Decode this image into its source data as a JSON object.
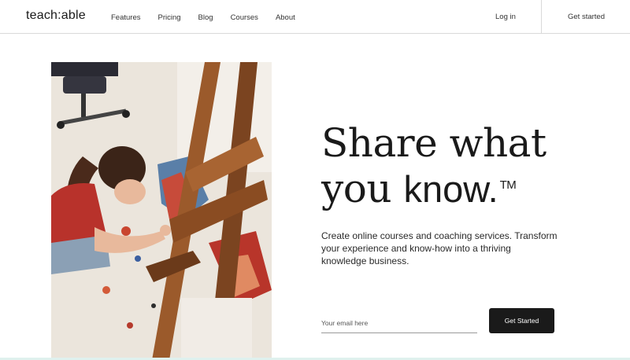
{
  "header": {
    "logo": "teach:able",
    "nav": [
      "Features",
      "Pricing",
      "Blog",
      "Courses",
      "About"
    ],
    "login": "Log in",
    "get_started": "Get started"
  },
  "hero": {
    "headline_line1": "Share what",
    "headline_line2_light": "you ",
    "headline_line2_strong": "know.",
    "trademark": "TM",
    "subcopy": "Create online courses and coaching services. Transform your experience and know-how into a thriving knowledge business.",
    "email_placeholder": "Your email here",
    "cta": "Get Started"
  },
  "colors": {
    "cta_background": "#1a1a1a",
    "divider": "#d9d9d9"
  }
}
